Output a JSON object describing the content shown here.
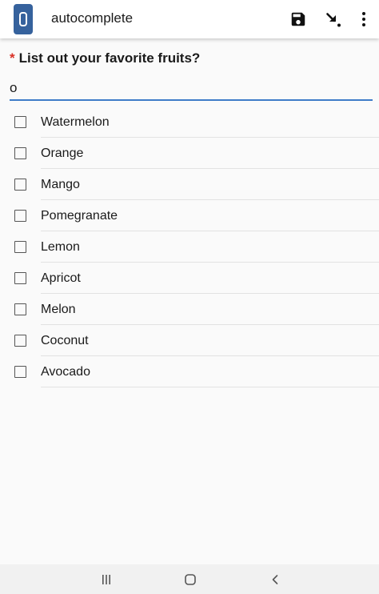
{
  "app": {
    "title": "autocomplete",
    "icon": "app-logo-icon",
    "actions": [
      {
        "name": "save",
        "icon": "save-icon"
      },
      {
        "name": "download",
        "icon": "arrow-down-right-icon"
      },
      {
        "name": "more",
        "icon": "more-vert-icon"
      }
    ]
  },
  "question": {
    "required_marker": "*",
    "text": "List out your favorite fruits?",
    "input_value": "o"
  },
  "options": [
    {
      "label": "Watermelon",
      "checked": false
    },
    {
      "label": "Orange",
      "checked": false
    },
    {
      "label": "Mango",
      "checked": false
    },
    {
      "label": "Pomegranate",
      "checked": false
    },
    {
      "label": "Lemon",
      "checked": false
    },
    {
      "label": "Apricot",
      "checked": false
    },
    {
      "label": "Melon",
      "checked": false
    },
    {
      "label": "Coconut",
      "checked": false
    },
    {
      "label": "Avocado",
      "checked": false
    }
  ],
  "navbar": {
    "buttons": [
      "recents-icon",
      "home-icon",
      "back-icon"
    ]
  },
  "colors": {
    "accent": "#3e7cc8",
    "required": "#d93025",
    "app_icon": "#36629d"
  }
}
